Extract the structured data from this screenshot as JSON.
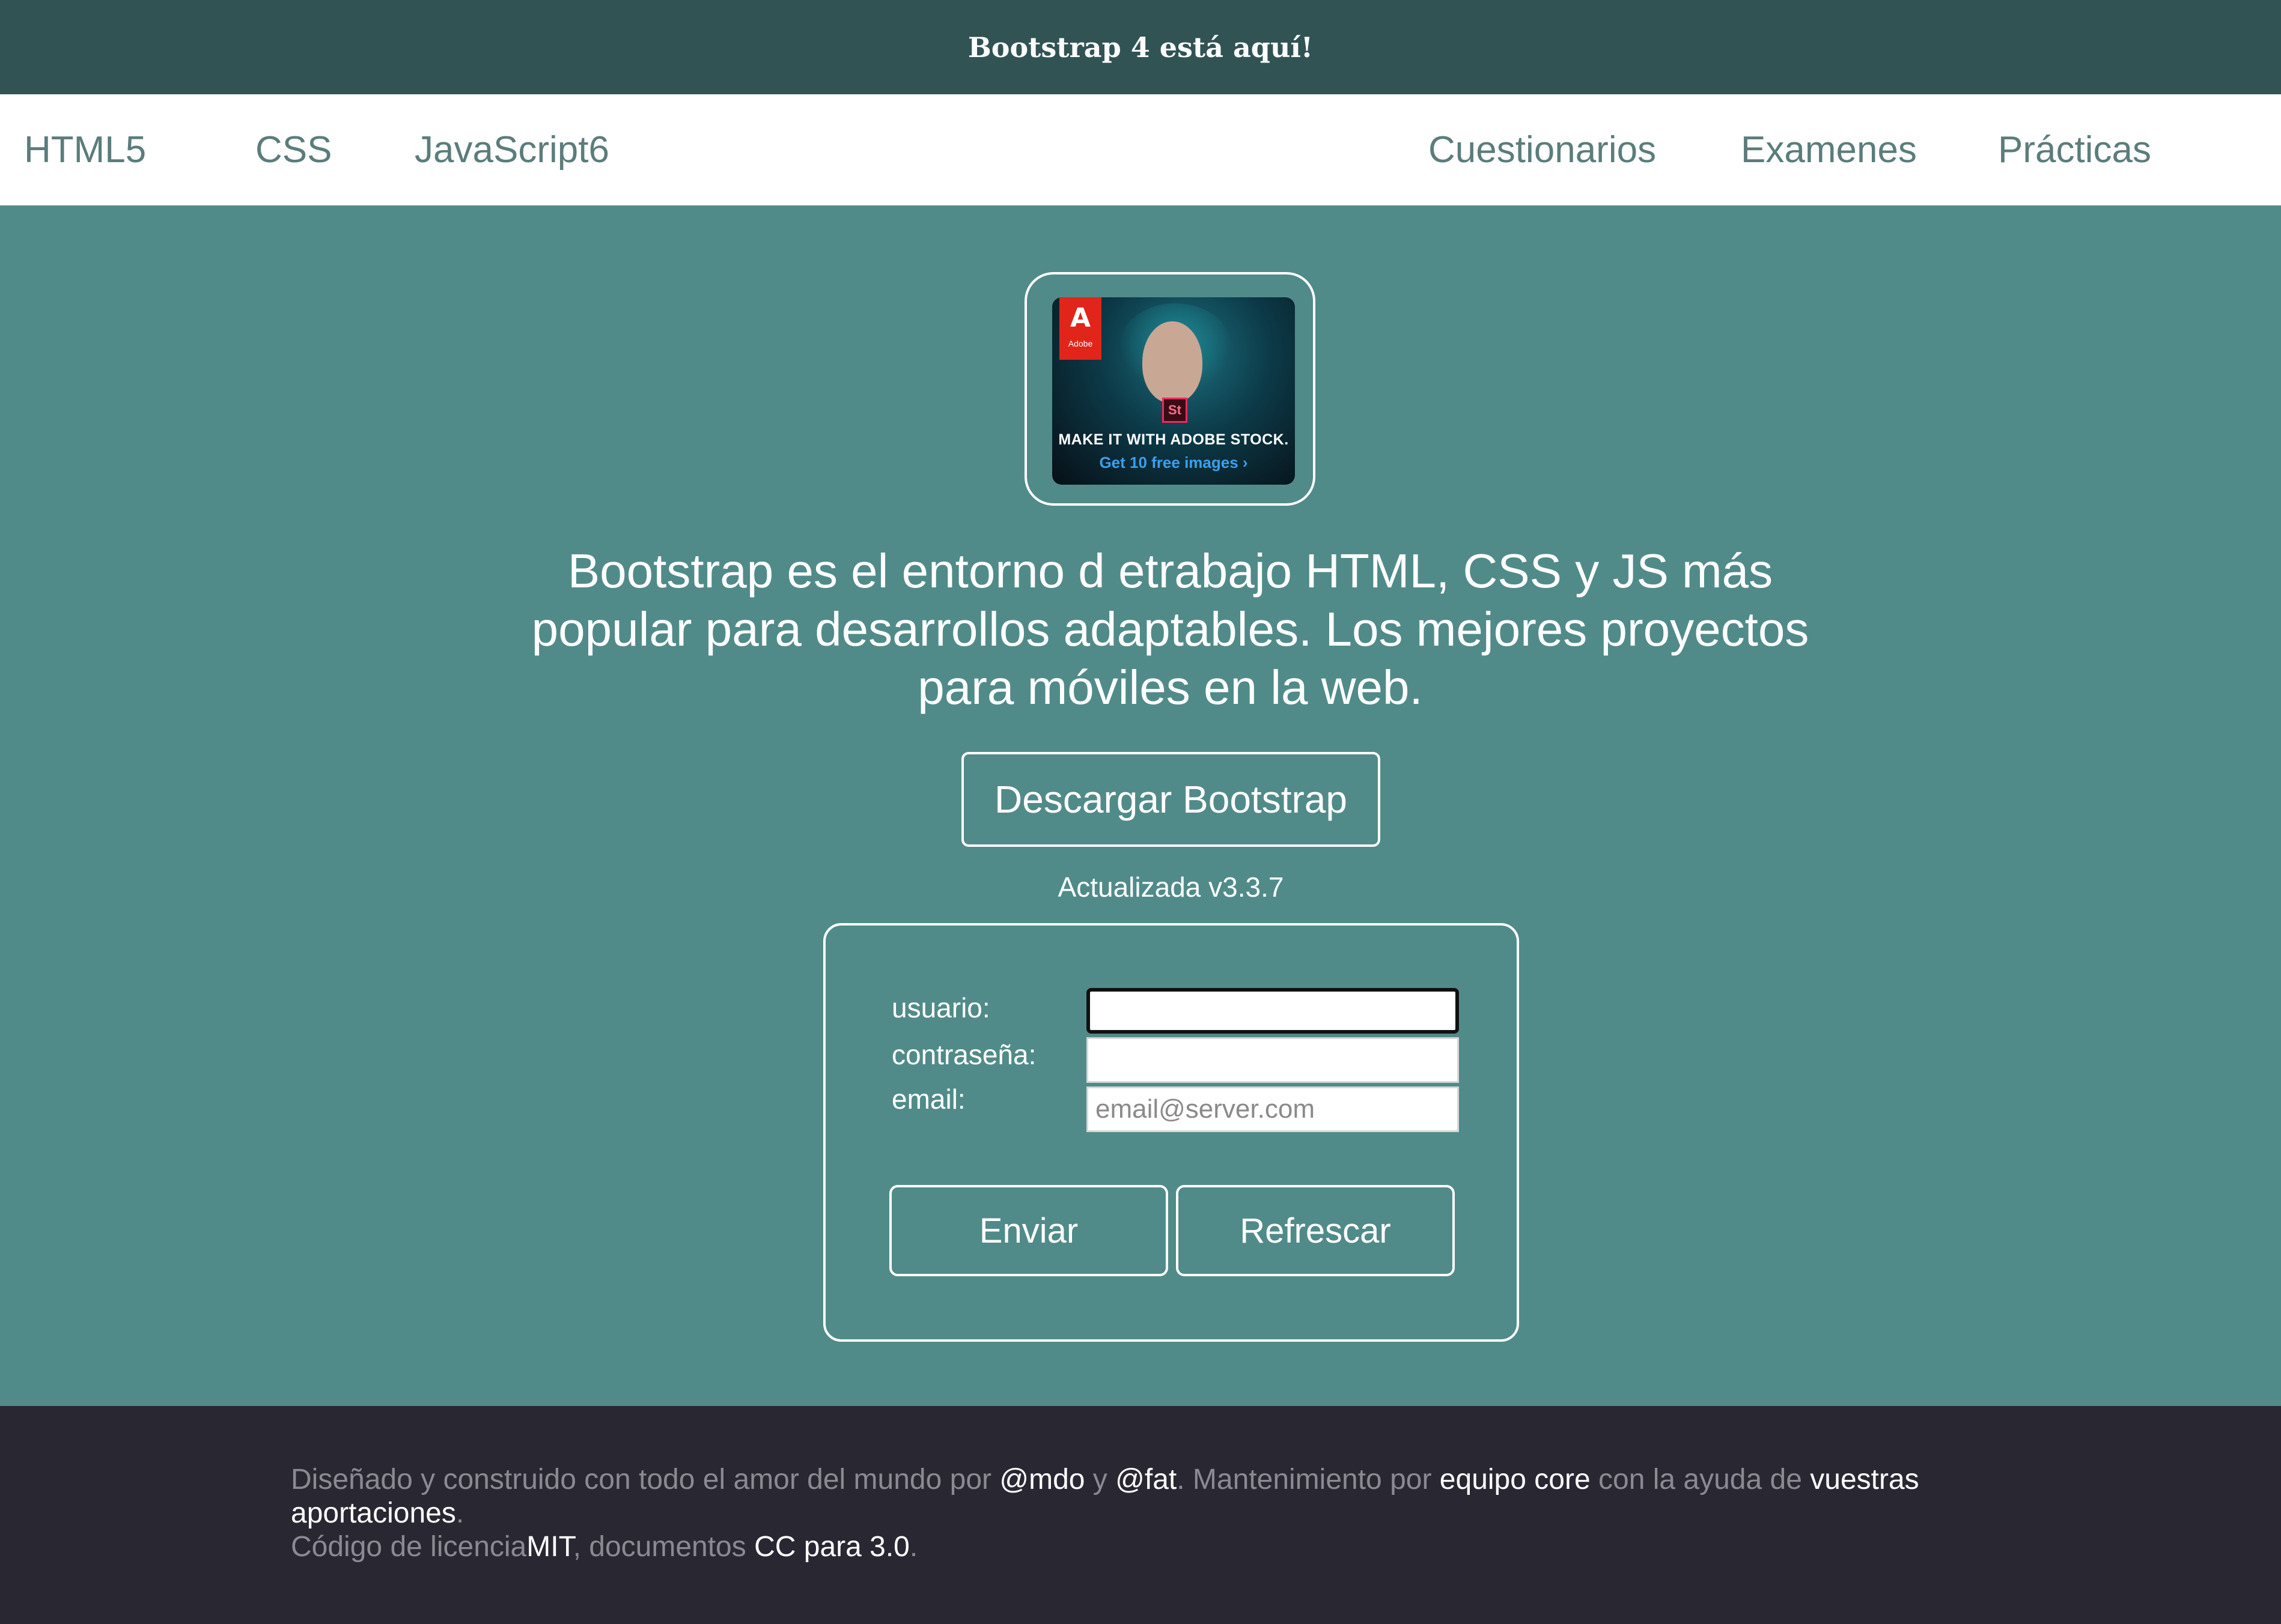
{
  "topbar": {
    "announcement": "Bootstrap 4 está aquí!"
  },
  "nav": {
    "left": [
      "HTML5",
      "CSS",
      "JavaScript6"
    ],
    "right": [
      "Cuestionarios",
      "Examenes",
      "Prácticas"
    ]
  },
  "ad": {
    "brand_icon": "adobe-logo-icon",
    "brand_word": "Adobe",
    "product_badge": "St",
    "headline": "MAKE IT WITH ADOBE STOCK.",
    "cta": "Get 10 free images ›"
  },
  "hero": {
    "lead": "Bootstrap es el entorno d etrabajo HTML, CSS y JS más popular para desarrollos adaptables. Los mejores proyectos para móviles en la web.",
    "download_button": "Descargar Bootstrap",
    "version": "Actualizada v3.3.7"
  },
  "form": {
    "user_label": "usuario:",
    "user_value": "",
    "password_label": "contraseña:",
    "password_value": "",
    "email_label": "email:",
    "email_value": "",
    "email_placeholder": "email@server.com",
    "submit_button": "Enviar",
    "reset_button": "Refrescar"
  },
  "footer": {
    "t1": "Diseñado y construido con todo el amor del mundo por ",
    "link_mdo": "@mdo",
    "t2": " y ",
    "link_fat": "@fat",
    "t3": ". Mantenimiento por ",
    "link_core": "equipo core",
    "t4": " con la ayuda de ",
    "link_contrib": "vuestras aportaciones",
    "t5": ".",
    "t6": "Código de licencia",
    "link_mit": "MIT",
    "t7": ", documentos ",
    "link_cc": "CC para 3.0",
    "t8": "."
  },
  "colors": {
    "topbar": "#315354",
    "navbar": "#ffffff",
    "nav_text": "#5b7d7b",
    "main": "#518b89",
    "footer": "#292732",
    "footer_text": "#8b8a92"
  }
}
